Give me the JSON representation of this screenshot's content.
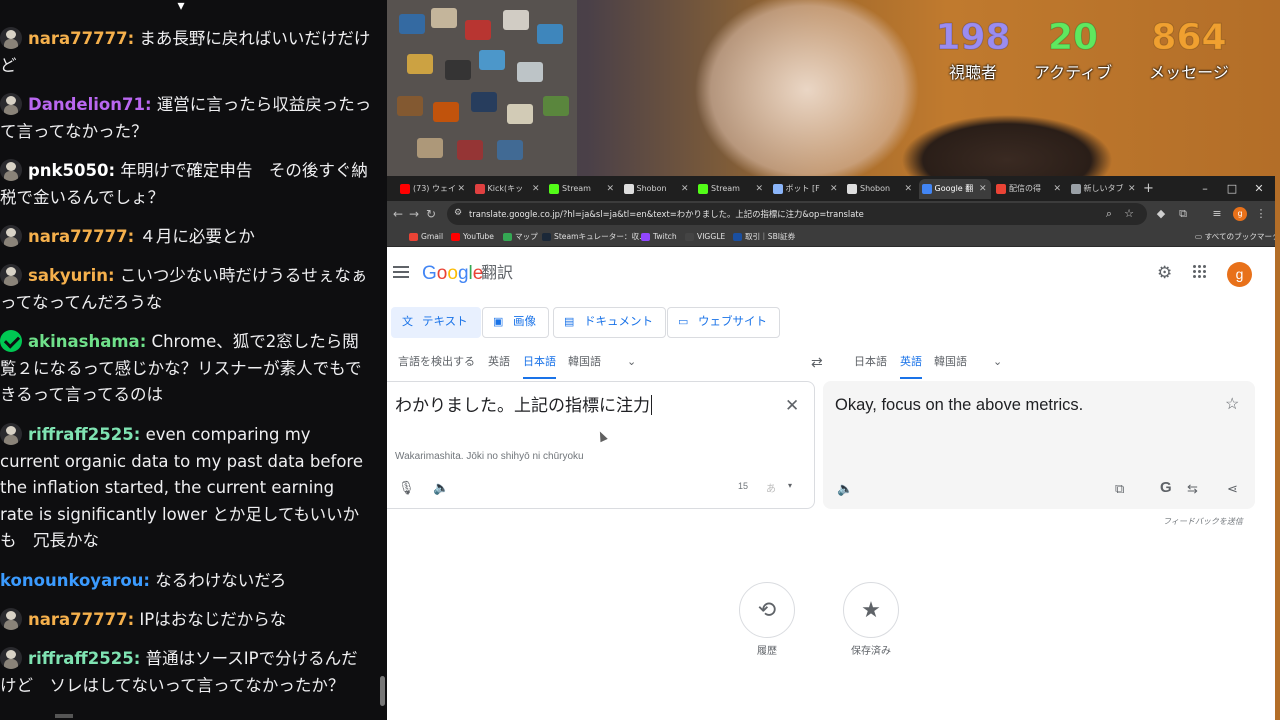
{
  "chat": {
    "messages": [
      {
        "user": "nara77777",
        "text": "まあ長野に戻ればいいだけだけど",
        "color": "#f5b04c",
        "badge": "avatar"
      },
      {
        "user": "Dandelion71",
        "text": "運営に言ったら収益戻ったって言ってなかった？",
        "color": "#b967f0",
        "badge": "avatar"
      },
      {
        "user": "pnk5050",
        "text": "年明けで確定申告　その後すぐ納税で金いるんでしょ？",
        "color": "#ffffff",
        "badge": "avatar"
      },
      {
        "user": "nara77777",
        "text": "４月に必要とか",
        "color": "#f5b04c",
        "badge": "avatar"
      },
      {
        "user": "sakyurin",
        "text": "こいつ少ない時だけうるせぇなぁってなってんだろうな",
        "color": "#f5b04c",
        "badge": "avatar"
      },
      {
        "user": "akinashama",
        "text": "Chrome、狐で2窓したら閲覧２になるって感じかな？リスナーが素人でもできるって言ってるのは",
        "color": "#6fe08a",
        "badge": "verified"
      },
      {
        "user": "riffraff2525",
        "text": "even comparing my current organic data to my past data before the inflation started, the current earning rate is significantly lower とか足してもいいかも　冗長かな",
        "color": "#7fe3b2",
        "badge": "avatar"
      },
      {
        "user": "konounkoyarou",
        "text": "なるわけないだろ",
        "color": "#3b9bff",
        "badge": "none"
      },
      {
        "user": "nara77777",
        "text": "IPはおなじだからな",
        "color": "#f5b04c",
        "badge": "avatar"
      },
      {
        "user": "riffraff2525",
        "text": "普通はソースIPで分けるんだけど　ソレはしてないって言ってなかったか？",
        "color": "#7fe3b2",
        "badge": "avatar"
      }
    ]
  },
  "stats": [
    {
      "value": "198",
      "label": "視聴者",
      "color": "#9b8cf0"
    },
    {
      "value": "20",
      "label": "アクティブ",
      "color": "#5fe85f"
    },
    {
      "value": "864",
      "label": "メッセージ",
      "color": "#f0a030"
    }
  ],
  "browser": {
    "tabs": [
      {
        "title": "(73) ウェイ",
        "color": "#ff0000"
      },
      {
        "title": "Kick(キッ",
        "color": "#e04040"
      },
      {
        "title": "Stream",
        "color": "#53fc18"
      },
      {
        "title": "Shobon",
        "color": "#dddddd"
      },
      {
        "title": "Stream",
        "color": "#53fc18"
      },
      {
        "title": "ボット [F",
        "color": "#8ab4f8"
      },
      {
        "title": "Shobon",
        "color": "#dddddd"
      },
      {
        "title": "Google 翻",
        "color": "#4285f4"
      },
      {
        "title": "配信の得",
        "color": "#ea4335"
      },
      {
        "title": "新しいタブ",
        "color": "#9aa0a6"
      }
    ],
    "url": "translate.google.co.jp/?hl=ja&sl=ja&tl=en&text=わかりました。上記の指標に注力&op=translate",
    "bookmarks": [
      {
        "label": "Gmail",
        "color": "#ea4335"
      },
      {
        "label": "YouTube",
        "color": "#ff0000"
      },
      {
        "label": "マップ",
        "color": "#34a853"
      },
      {
        "label": "Steamキュレーター：収...",
        "color": "#1b2838"
      },
      {
        "label": "Twitch",
        "color": "#9146ff"
      },
      {
        "label": "VIGGLE",
        "color": "#444444"
      },
      {
        "label": "取引｜SBI証券",
        "color": "#1a4fa0"
      }
    ],
    "bookmarks_all": "すべてのブックマーク",
    "profile_initial": "g"
  },
  "translate": {
    "product": "翻訳",
    "avatar_initial": "g",
    "modes": [
      "テキスト",
      "画像",
      "ドキュメント",
      "ウェブサイト"
    ],
    "source_langs": [
      "言語を検出する",
      "英語",
      "日本語",
      "韓国語"
    ],
    "target_langs": [
      "日本語",
      "英語",
      "韓国語"
    ],
    "source_text": "わかりました。上記の指標に注力",
    "romanization": "Wakarimashita. Jōki no shihyō ni chūryoku",
    "char_count": "15",
    "ime_label": "あ",
    "target_text": "Okay, focus on the above metrics.",
    "feedback": "フィードバックを送信",
    "history_label": "履歴",
    "saved_label": "保存済み"
  }
}
